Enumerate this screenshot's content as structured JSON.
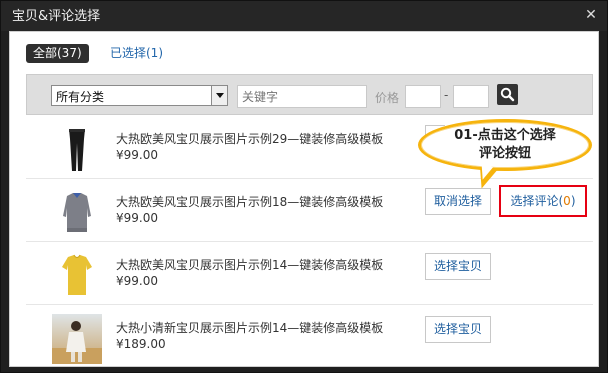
{
  "dialog": {
    "title": "宝贝&评论选择",
    "close_icon": "close-icon"
  },
  "tabs": {
    "all": "全部(37)",
    "selected": "已选择(1)"
  },
  "filters": {
    "category": "所有分类",
    "keyword_placeholder": "关键字",
    "price_label": "价格",
    "price_separator": "-"
  },
  "items": [
    {
      "name": "大热欧美风宝贝展示图片示例29—键装修高级模板",
      "price": "¥99.00"
    },
    {
      "name": "大热欧美风宝贝展示图片示例18—键装修高级模板",
      "price": "¥99.00",
      "btn_cancel": "取消选择",
      "btn_review_text": "选择评论(",
      "btn_review_count": "0",
      "btn_review_close": ")"
    },
    {
      "name": "大热欧美风宝贝展示图片示例14—键装修高级模板",
      "price": "¥99.00",
      "btn_select": "选择宝贝"
    },
    {
      "name": "大热小清新宝贝展示图片示例14—键装修高级模板",
      "price": "¥189.00",
      "btn_select": "选择宝贝"
    }
  ],
  "callout": {
    "line1": "01-点击这个选择",
    "line2": "评论按钮"
  },
  "colors": {
    "highlight": "#e60012",
    "callout_border": "#f6b40e",
    "link": "#1f5e9e",
    "count": "#e07a00"
  }
}
